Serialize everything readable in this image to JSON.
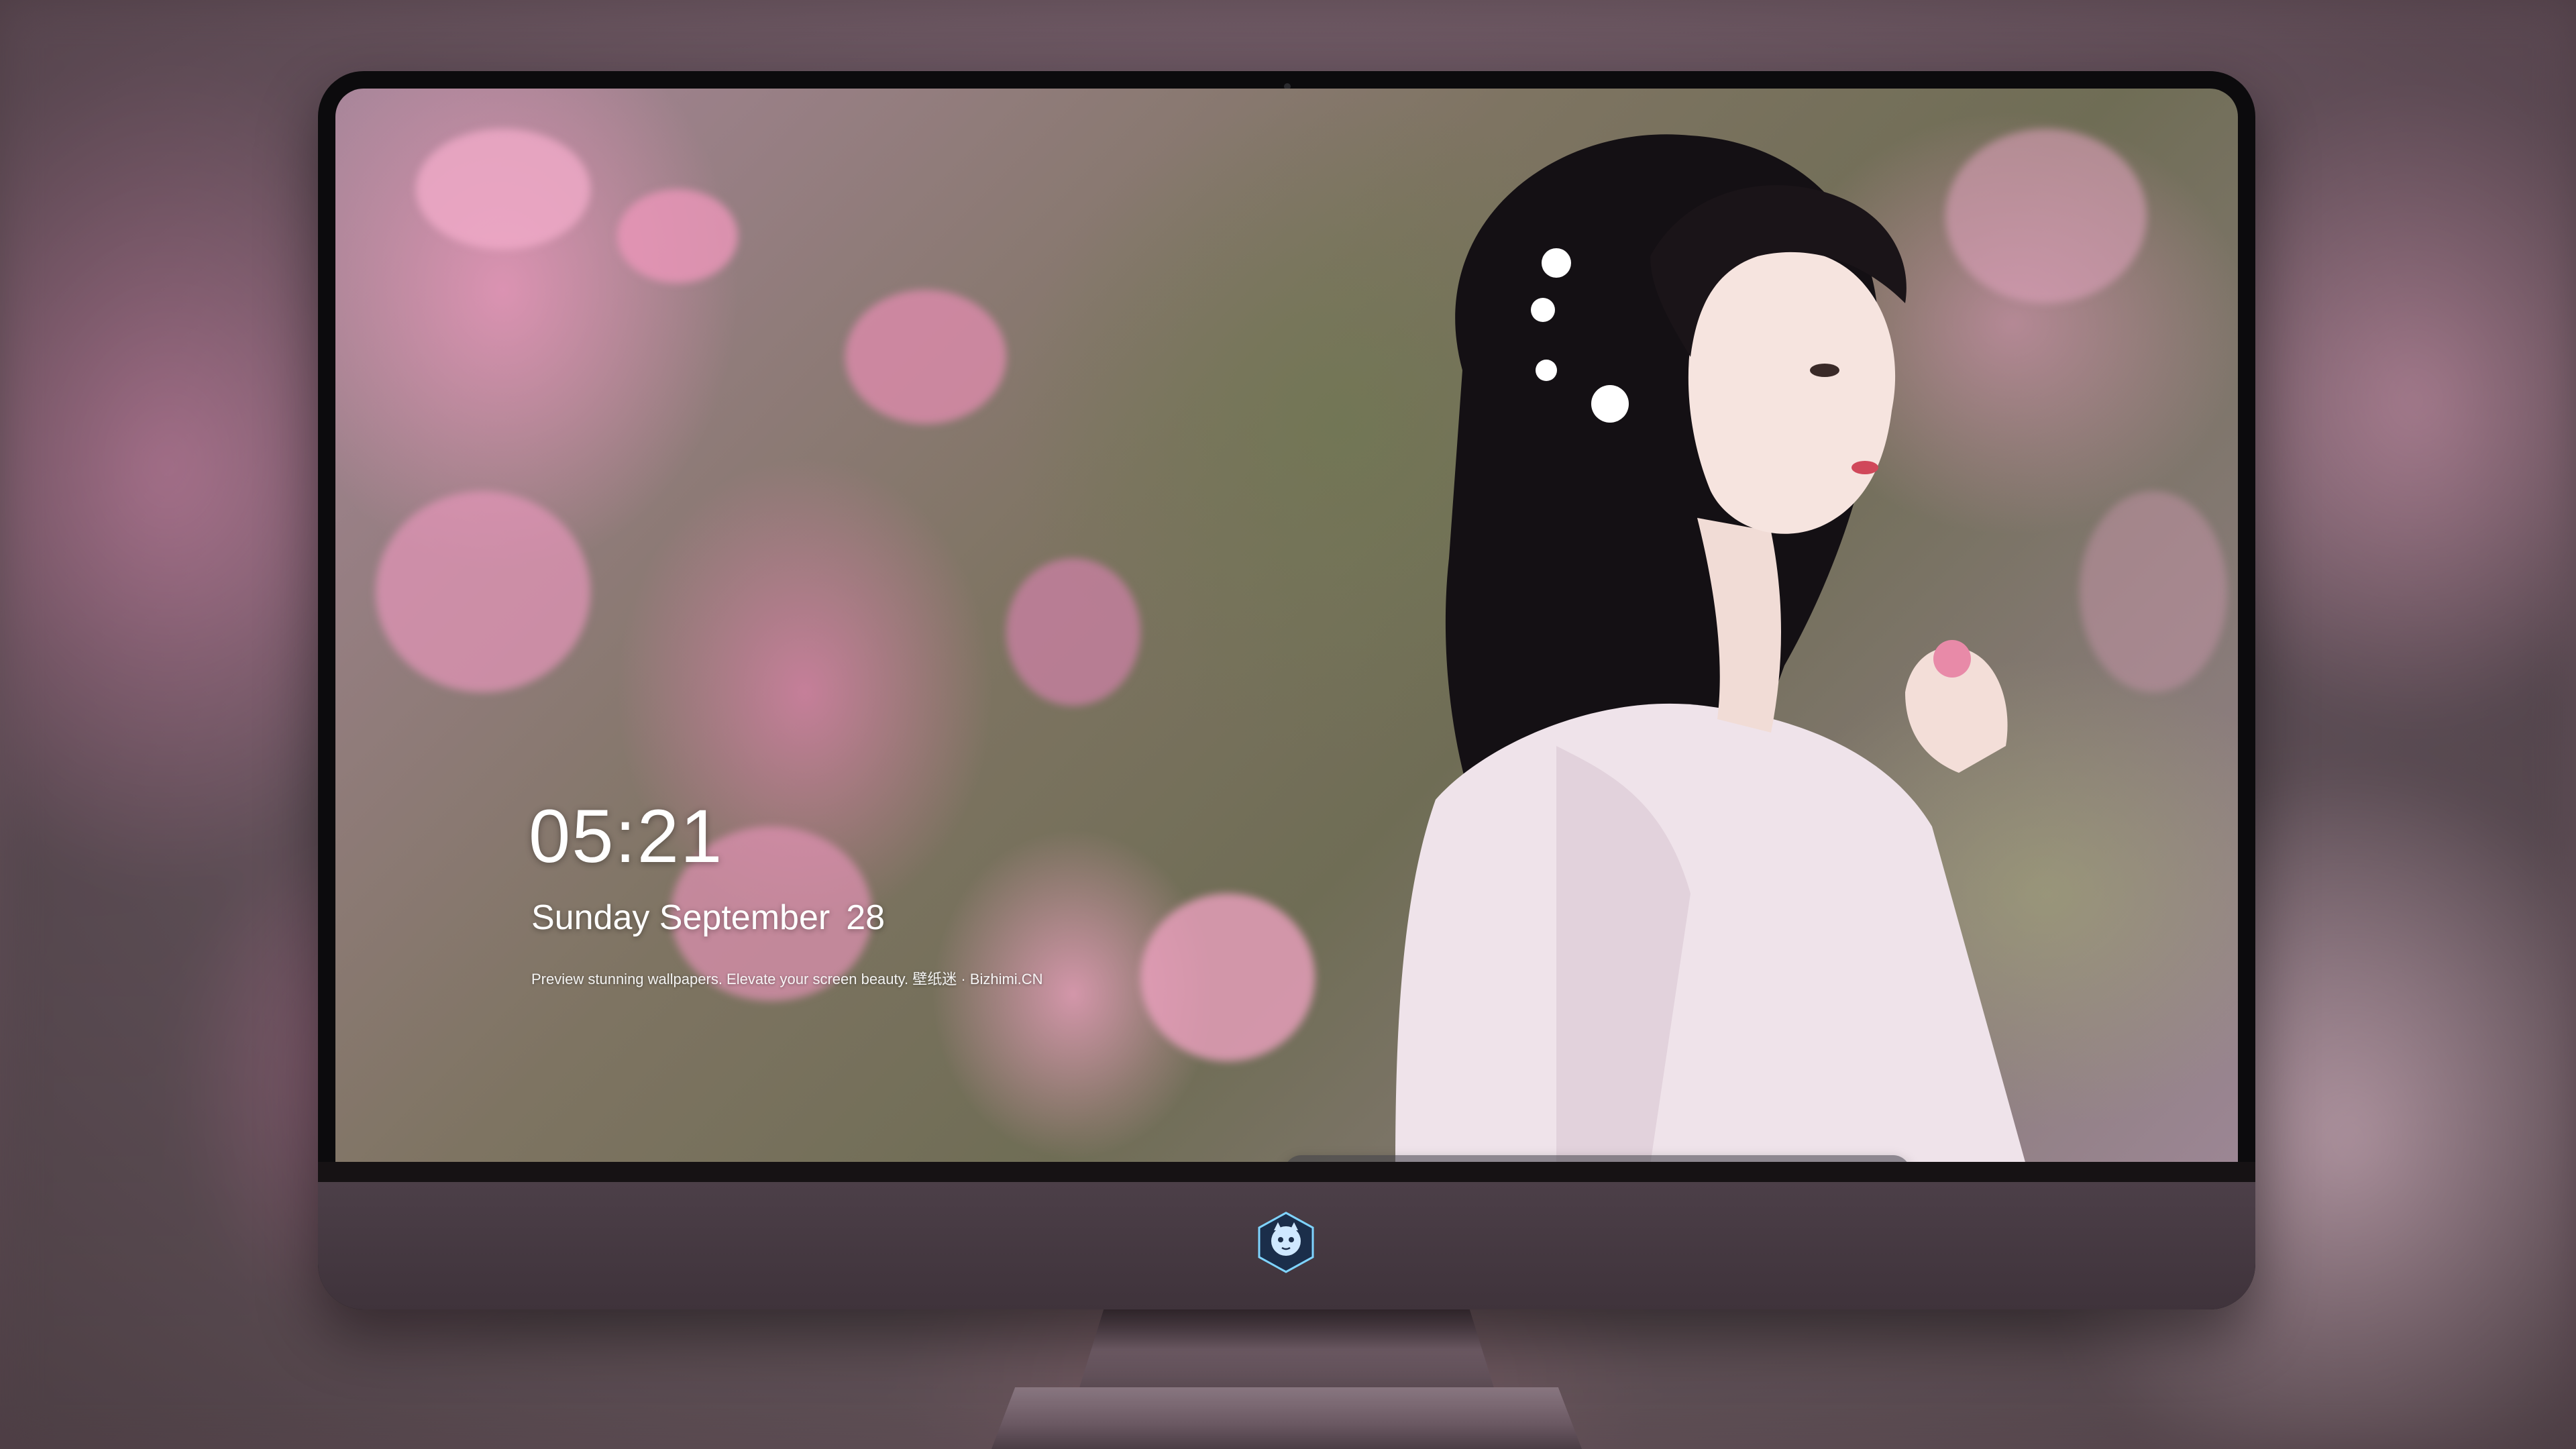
{
  "lock_screen": {
    "time": "05:21",
    "weekday_month": "Sunday September",
    "day": "28",
    "tagline": "Preview stunning wallpapers. Elevate your screen beauty. 壁纸迷 · Bizhimi.CN"
  },
  "dock": {
    "apps": [
      {
        "name": "messages-icon",
        "color": "#34c759"
      },
      {
        "name": "weather-icon",
        "color": "#1e90ff"
      },
      {
        "name": "clock-icon",
        "color": "#1c1c1e"
      },
      {
        "name": "preview-icon",
        "color": "#f2c744"
      },
      {
        "name": "clips-icon",
        "color": "#5ac8fa"
      },
      {
        "name": "notes-icon",
        "color": "#ffd60a"
      },
      {
        "name": "photo-gallery-icon",
        "color": "#e5e5ea"
      },
      {
        "name": "music-icon",
        "color": "#fc3c8d"
      },
      {
        "name": "app-store-icon",
        "color": "#0a84ff"
      },
      {
        "name": "camera-icon",
        "color": "#8e8e93"
      }
    ]
  },
  "monitor": {
    "brand_logo": "mascot-logo-icon"
  }
}
